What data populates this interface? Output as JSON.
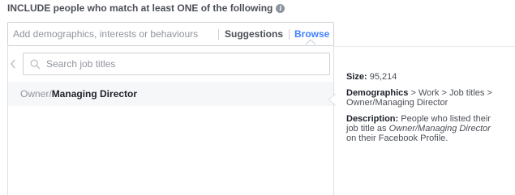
{
  "heading": {
    "text": "INCLUDE people who match at least ONE of the following",
    "icon": "info-icon"
  },
  "targeting": {
    "placeholder": "Add demographics, interests or behaviours",
    "suggestions_label": "Suggestions",
    "browse_label": "Browse",
    "browse_color": "#4080ff"
  },
  "dropdown": {
    "search_placeholder": "Search job titles",
    "result": {
      "path": "Owner/",
      "name": "Managing Director"
    }
  },
  "details": {
    "size_label": "Size:",
    "size_value": "95,214",
    "category_label": "Demographics",
    "category_path": "> Work > Job titles > Owner/Managing Director",
    "description_label": "Description:",
    "description_pre": "People who listed their job title as",
    "description_title": "Owner/Managing Director",
    "description_post": "on their Facebook Profile."
  }
}
